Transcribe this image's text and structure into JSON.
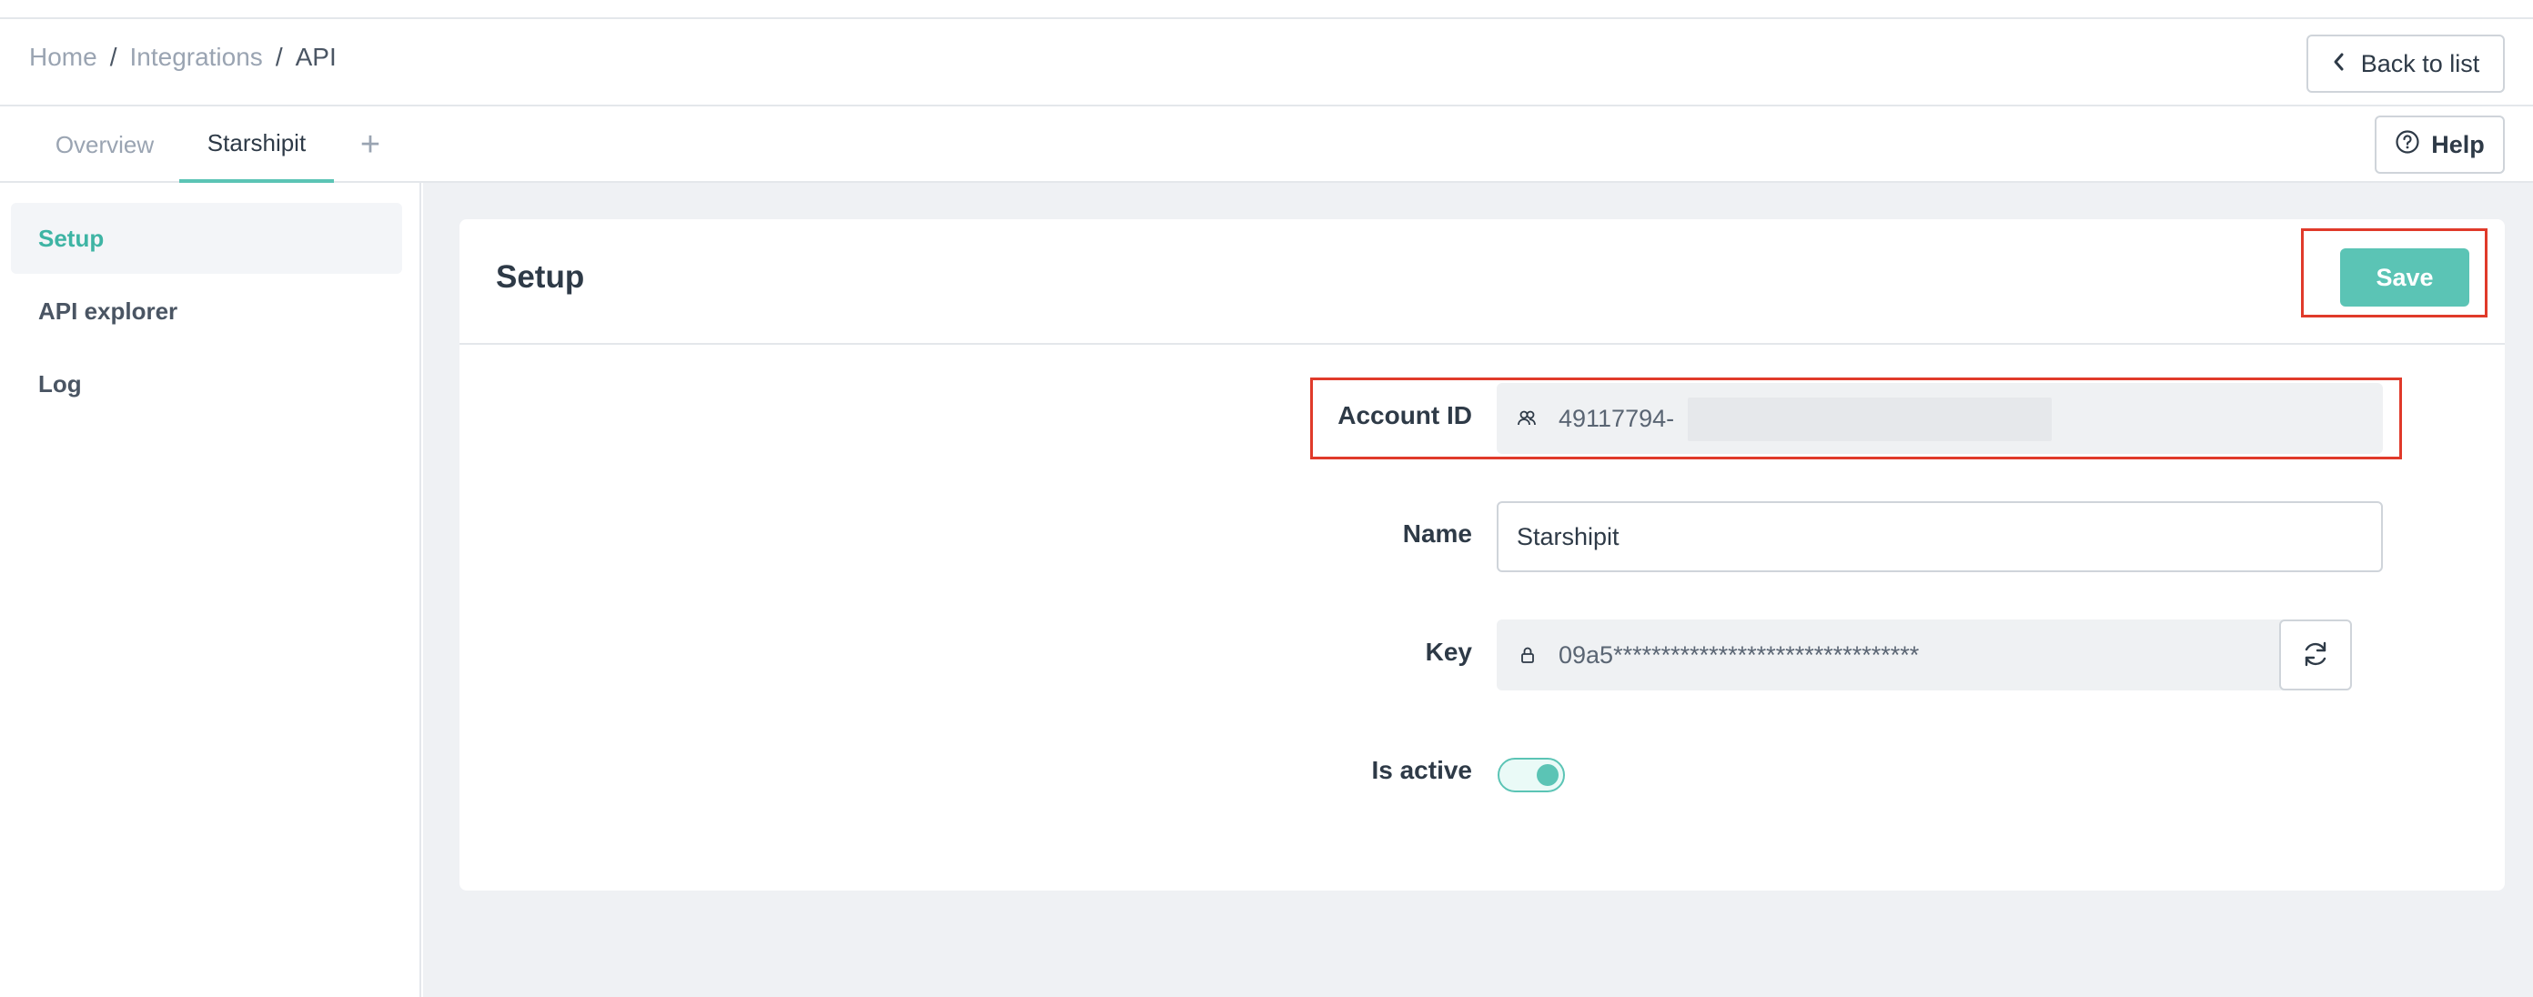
{
  "breadcrumb": {
    "items": [
      "Home",
      "Integrations",
      "API"
    ],
    "separator": "/"
  },
  "header": {
    "back_label": "Back to list",
    "back_icon": "chevron-left-icon"
  },
  "tabs": {
    "items": [
      {
        "label": "Overview",
        "active": false
      },
      {
        "label": "Starshipit",
        "active": true
      }
    ],
    "add_label": "+",
    "help_label": "Help",
    "help_icon": "question-circle-icon"
  },
  "sidebar": {
    "items": [
      {
        "label": "Setup",
        "active": true
      },
      {
        "label": "API explorer",
        "active": false
      },
      {
        "label": "Log",
        "active": false
      }
    ]
  },
  "card": {
    "title": "Setup",
    "save_label": "Save"
  },
  "form": {
    "account_id": {
      "label": "Account ID",
      "value": "49117794-",
      "icon": "users-icon"
    },
    "name": {
      "label": "Name",
      "value": "Starshipit"
    },
    "key": {
      "label": "Key",
      "value": "09a5********************************",
      "icon": "lock-icon",
      "refresh_icon": "refresh-icon"
    },
    "is_active": {
      "label": "Is active",
      "value": true
    }
  },
  "colors": {
    "accent": "#5bc4b5",
    "highlight": "#e03a2a",
    "background": "#eff1f4"
  }
}
